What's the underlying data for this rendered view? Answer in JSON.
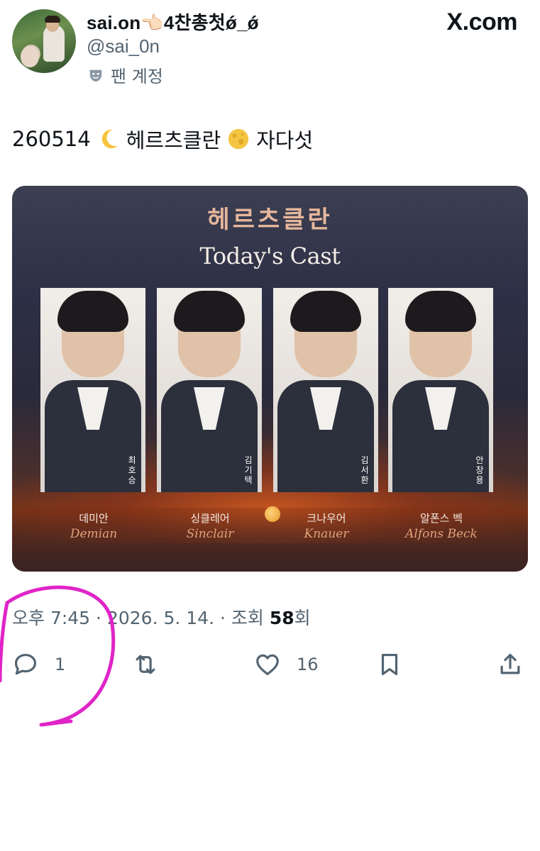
{
  "header": {
    "display_name": "sai.on👈🏻4찬총첫ǿ_ǿ",
    "handle": "@sai_0n",
    "fan_label": "팬 계정",
    "site": "X.com"
  },
  "tweet": {
    "text_part1": "260514",
    "text_part2": "헤르츠클란",
    "text_part3": "자다섯"
  },
  "photo": {
    "title": "헤르츠클란",
    "subtitle": "Today's Cast",
    "cards": [
      {
        "actor": "최호승",
        "role_kr": "데미안",
        "role_en": "Demian"
      },
      {
        "actor": "김기택",
        "role_kr": "싱클레어",
        "role_en": "Sinclair"
      },
      {
        "actor": "김서환",
        "role_kr": "크나우어",
        "role_en": "Knauer"
      },
      {
        "actor": "안창용",
        "role_kr": "알폰스 벡",
        "role_en": "Alfons Beck"
      }
    ]
  },
  "meta": {
    "time": "오후 7:45",
    "date": "2026. 5. 14.",
    "views_label": "조회",
    "views_count": "58",
    "views_suffix": "회"
  },
  "actions": {
    "reply_count": "1",
    "like_count": "16"
  },
  "annotation_color": "#e024c8"
}
